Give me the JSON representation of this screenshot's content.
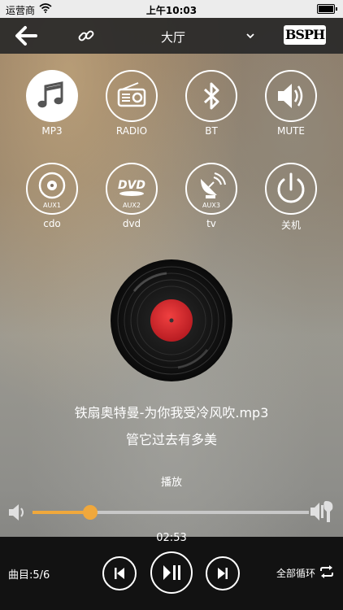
{
  "status_bar": {
    "carrier": "运营商",
    "time": "上午10:03"
  },
  "nav": {
    "room": "大厅",
    "logo": "BSPH"
  },
  "sources": [
    {
      "label": "MP3",
      "icon": "music-note-icon",
      "active": true
    },
    {
      "label": "RADIO",
      "icon": "radio-icon",
      "active": false
    },
    {
      "label": "BT",
      "icon": "bluetooth-icon",
      "active": false
    },
    {
      "label": "MUTE",
      "icon": "speaker-icon",
      "active": false
    },
    {
      "label": "cdo",
      "icon": "cd-aux1-icon",
      "sub": "AUX1",
      "active": false
    },
    {
      "label": "dvd",
      "icon": "dvd-aux2-icon",
      "sub": "AUX2",
      "active": false
    },
    {
      "label": "tv",
      "icon": "satellite-aux3-icon",
      "sub": "AUX3",
      "active": false
    },
    {
      "label": "关机",
      "icon": "power-icon",
      "active": false
    }
  ],
  "player": {
    "title": "铁扇奥特曼-为你我受冷风吹.mp3",
    "lyric": "管它过去有多美",
    "state": "播放",
    "elapsed": "02:53",
    "progress_fraction": 0.21,
    "track_count": "曲目:5/6",
    "repeat_mode": "全部循环"
  },
  "colors": {
    "accent": "#f0a83c",
    "disc_label": "#d9262c"
  }
}
